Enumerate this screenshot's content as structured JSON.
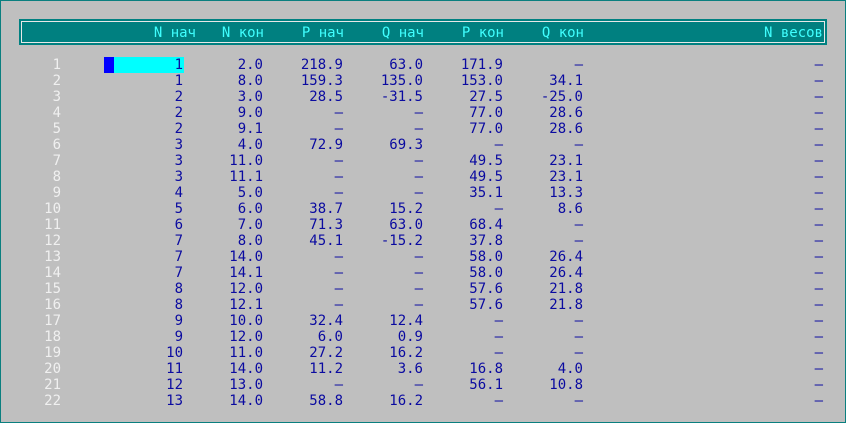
{
  "header": {
    "n_nach": "N нач",
    "n_kon": "N кон",
    "p_nach": "P нач",
    "q_nach": "Q нач",
    "p_kon": "P кон",
    "q_kon": "Q кон",
    "n_vesov": "N весов"
  },
  "rows": [
    {
      "i": "1",
      "n1": "1",
      "n2": "2.0",
      "p1": "218.9",
      "q1": "63.0",
      "p2": "171.9",
      "q2": "–",
      "w": "–"
    },
    {
      "i": "2",
      "n1": "1",
      "n2": "8.0",
      "p1": "159.3",
      "q1": "135.0",
      "p2": "153.0",
      "q2": "34.1",
      "w": "–"
    },
    {
      "i": "3",
      "n1": "2",
      "n2": "3.0",
      "p1": "28.5",
      "q1": "-31.5",
      "p2": "27.5",
      "q2": "-25.0",
      "w": "–"
    },
    {
      "i": "4",
      "n1": "2",
      "n2": "9.0",
      "p1": "–",
      "q1": "–",
      "p2": "77.0",
      "q2": "28.6",
      "w": "–"
    },
    {
      "i": "5",
      "n1": "2",
      "n2": "9.1",
      "p1": "–",
      "q1": "–",
      "p2": "77.0",
      "q2": "28.6",
      "w": "–"
    },
    {
      "i": "6",
      "n1": "3",
      "n2": "4.0",
      "p1": "72.9",
      "q1": "69.3",
      "p2": "–",
      "q2": "–",
      "w": "–"
    },
    {
      "i": "7",
      "n1": "3",
      "n2": "11.0",
      "p1": "–",
      "q1": "–",
      "p2": "49.5",
      "q2": "23.1",
      "w": "–"
    },
    {
      "i": "8",
      "n1": "3",
      "n2": "11.1",
      "p1": "–",
      "q1": "–",
      "p2": "49.5",
      "q2": "23.1",
      "w": "–"
    },
    {
      "i": "9",
      "n1": "4",
      "n2": "5.0",
      "p1": "–",
      "q1": "–",
      "p2": "35.1",
      "q2": "13.3",
      "w": "–"
    },
    {
      "i": "10",
      "n1": "5",
      "n2": "6.0",
      "p1": "38.7",
      "q1": "15.2",
      "p2": "–",
      "q2": "8.6",
      "w": "–"
    },
    {
      "i": "11",
      "n1": "6",
      "n2": "7.0",
      "p1": "71.3",
      "q1": "63.0",
      "p2": "68.4",
      "q2": "–",
      "w": "–"
    },
    {
      "i": "12",
      "n1": "7",
      "n2": "8.0",
      "p1": "45.1",
      "q1": "-15.2",
      "p2": "37.8",
      "q2": "–",
      "w": "–"
    },
    {
      "i": "13",
      "n1": "7",
      "n2": "14.0",
      "p1": "–",
      "q1": "–",
      "p2": "58.0",
      "q2": "26.4",
      "w": "–"
    },
    {
      "i": "14",
      "n1": "7",
      "n2": "14.1",
      "p1": "–",
      "q1": "–",
      "p2": "58.0",
      "q2": "26.4",
      "w": "–"
    },
    {
      "i": "15",
      "n1": "8",
      "n2": "12.0",
      "p1": "–",
      "q1": "–",
      "p2": "57.6",
      "q2": "21.8",
      "w": "–"
    },
    {
      "i": "16",
      "n1": "8",
      "n2": "12.1",
      "p1": "–",
      "q1": "–",
      "p2": "57.6",
      "q2": "21.8",
      "w": "–"
    },
    {
      "i": "17",
      "n1": "9",
      "n2": "10.0",
      "p1": "32.4",
      "q1": "12.4",
      "p2": "–",
      "q2": "–",
      "w": "–"
    },
    {
      "i": "18",
      "n1": "9",
      "n2": "12.0",
      "p1": "6.0",
      "q1": "0.9",
      "p2": "–",
      "q2": "–",
      "w": "–"
    },
    {
      "i": "19",
      "n1": "10",
      "n2": "11.0",
      "p1": "27.2",
      "q1": "16.2",
      "p2": "–",
      "q2": "–",
      "w": "–"
    },
    {
      "i": "20",
      "n1": "11",
      "n2": "14.0",
      "p1": "11.2",
      "q1": "3.6",
      "p2": "16.8",
      "q2": "4.0",
      "w": "–"
    },
    {
      "i": "21",
      "n1": "12",
      "n2": "13.0",
      "p1": "–",
      "q1": "–",
      "p2": "56.1",
      "q2": "10.8",
      "w": "–"
    },
    {
      "i": "22",
      "n1": "13",
      "n2": "14.0",
      "p1": "58.8",
      "q1": "16.2",
      "p2": "–",
      "q2": "–",
      "w": "–"
    }
  ],
  "colors": {
    "background": "#c0c0c0",
    "header_bg": "#008080",
    "header_text": "#40ffff",
    "cell_text": "#0a0aa0",
    "row_index_text": "#f0f0f0",
    "cursor_bar": "#00ffff",
    "cursor_block": "#0000ff"
  }
}
